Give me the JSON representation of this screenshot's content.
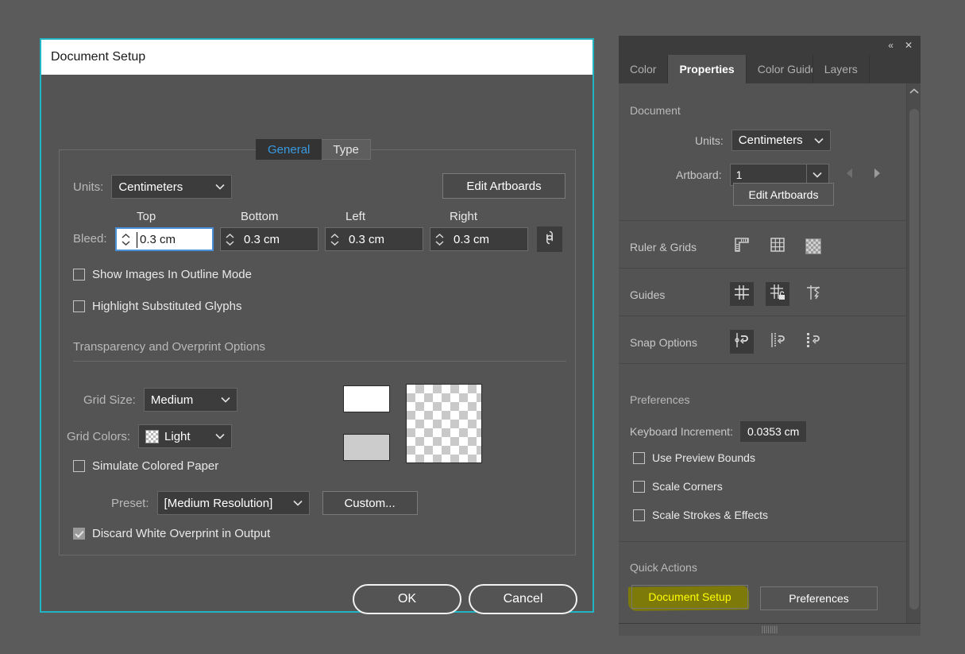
{
  "dialog": {
    "title": "Document Setup",
    "tabs": [
      {
        "label": "General",
        "active": true
      },
      {
        "label": "Type",
        "active": false
      }
    ],
    "units": {
      "label": "Units:",
      "value": "Centimeters"
    },
    "edit_artboards_label": "Edit Artboards",
    "bleed": {
      "label": "Bleed:",
      "columns": [
        "Top",
        "Bottom",
        "Left",
        "Right"
      ],
      "values": [
        "0.3 cm",
        "0.3 cm",
        "0.3 cm",
        "0.3 cm"
      ],
      "focused_index": 0,
      "link_icon": "link-chain-icon"
    },
    "checkboxes": [
      {
        "label": "Show Images In Outline Mode",
        "checked": false
      },
      {
        "label": "Highlight Substituted Glyphs",
        "checked": false
      }
    ],
    "transparency": {
      "section_title": "Transparency and Overprint Options",
      "grid_size": {
        "label": "Grid Size:",
        "value": "Medium"
      },
      "grid_colors": {
        "label": "Grid Colors:",
        "value": "Light",
        "swatch": "checkerboard-swatch"
      },
      "swatch_top_color": "#ffffff",
      "swatch_bottom_color": "#cccccc",
      "simulate_colored_paper": {
        "label": "Simulate Colored Paper",
        "checked": false
      },
      "preset": {
        "label": "Preset:",
        "value": "[Medium Resolution]"
      },
      "custom_label": "Custom...",
      "discard_white_overprint": {
        "label": "Discard White Overprint in Output",
        "checked": true
      }
    },
    "ok_label": "OK",
    "cancel_label": "Cancel"
  },
  "panel": {
    "header_icons": {
      "collapse": "«",
      "close": "✕"
    },
    "tabs": [
      {
        "label": "Color",
        "active": false
      },
      {
        "label": "Properties",
        "active": true
      },
      {
        "label": "Color Guide",
        "active": false
      },
      {
        "label": "Layers",
        "active": false
      }
    ],
    "document": {
      "section_title": "Document",
      "units": {
        "label": "Units:",
        "value": "Centimeters"
      },
      "artboard": {
        "label": "Artboard:",
        "value": "1"
      },
      "edit_artboards_label": "Edit Artboards",
      "prev_icon": "triangle-left-icon",
      "next_icon": "triangle-right-icon"
    },
    "ruler_grids": {
      "label": "Ruler & Grids",
      "icons": [
        "ruler-icon",
        "grid-icon",
        "transparency-grid-icon"
      ]
    },
    "guides": {
      "label": "Guides",
      "icons": [
        "show-guides-icon",
        "lock-guides-icon",
        "clear-guides-icon"
      ]
    },
    "snap_options": {
      "label": "Snap Options",
      "icons": [
        "snap-to-point-icon",
        "snap-to-grid-icon",
        "snap-to-pixel-icon"
      ]
    },
    "preferences": {
      "section_title": "Preferences",
      "keyboard_increment": {
        "label": "Keyboard Increment:",
        "value": "0.0353 cm"
      },
      "checkboxes": [
        {
          "label": "Use Preview Bounds",
          "checked": false
        },
        {
          "label": "Scale Corners",
          "checked": false
        },
        {
          "label": "Scale Strokes & Effects",
          "checked": false
        }
      ]
    },
    "quick_actions": {
      "section_title": "Quick Actions",
      "buttons": [
        {
          "label": "Document Setup",
          "highlighted": true
        },
        {
          "label": "Preferences",
          "highlighted": false
        }
      ]
    }
  },
  "colors": {
    "accent_border": "#21b5c4",
    "active_tab_text": "#3a9ae0",
    "focus_border": "#4a90d9",
    "highlight_ink": "#7d7a09",
    "highlight_text": "#ffff00"
  }
}
